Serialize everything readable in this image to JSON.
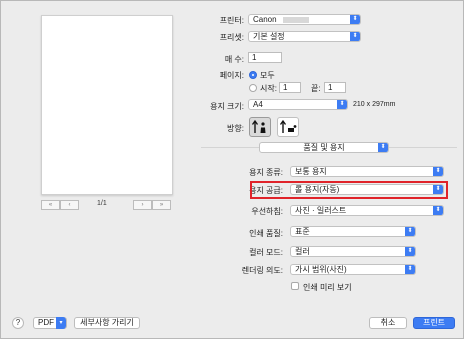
{
  "printer": {
    "label": "프린터:",
    "value": "Canon"
  },
  "preset": {
    "label": "프리셋:",
    "value": "기본 설정"
  },
  "copies": {
    "label": "매 수:",
    "value": "1"
  },
  "pages": {
    "label": "페이지:",
    "all": "모두",
    "from_label": "시작:",
    "from_value": "1",
    "to_label": "끝:",
    "to_value": "1"
  },
  "paper_size": {
    "label": "용지 크기:",
    "value": "A4",
    "dims": "210 x 297mm"
  },
  "orientation": {
    "label": "방향:"
  },
  "panel": {
    "value": "품질 및 용지"
  },
  "media_type": {
    "label": "용지 종류:",
    "value": "보통 용지"
  },
  "paper_source": {
    "label": "용지 공급:",
    "value": "롤 용지(자동)"
  },
  "priority": {
    "label": "우선하침:",
    "value": "사진 · 일러스트"
  },
  "print_quality": {
    "label": "인쇄 품질:",
    "value": "표준"
  },
  "color_mode": {
    "label": "컬러 모드:",
    "value": "컬러"
  },
  "rendering_intent": {
    "label": "렌더링 의도:",
    "value": "가시 범위(사진)"
  },
  "print_preview": {
    "label": "인쇄 미리 보기"
  },
  "preview_nav": {
    "page": "1/1"
  },
  "footer": {
    "help": "?",
    "pdf": "PDF",
    "details": "세부사항 가리기",
    "cancel": "취소",
    "print": "프린트"
  },
  "colors": {
    "accent": "#3d7cf3",
    "highlight": "#e0232a"
  }
}
